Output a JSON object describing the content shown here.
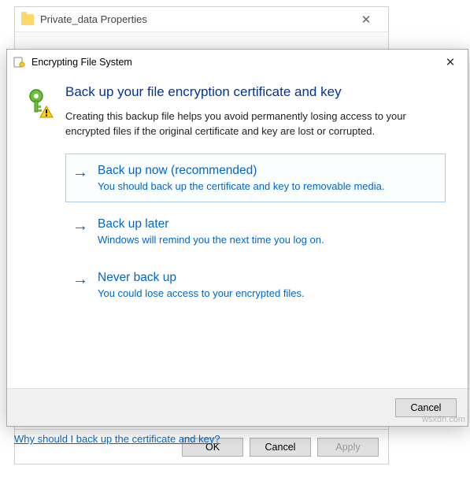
{
  "bg_window": {
    "title": "Private_data Properties",
    "buttons": {
      "ok": "OK",
      "cancel": "Cancel",
      "apply": "Apply"
    }
  },
  "dialog": {
    "title": "Encrypting File System",
    "heading": "Back up your file encryption certificate and key",
    "subtext": "Creating this backup file helps you avoid permanently losing access to your encrypted files if the original certificate and key are lost or corrupted.",
    "options": [
      {
        "title": "Back up now (recommended)",
        "desc": "You should back up the certificate and key to removable media."
      },
      {
        "title": "Back up later",
        "desc": "Windows will remind you the next time you log on."
      },
      {
        "title": "Never back up",
        "desc": "You could lose access to your encrypted files."
      }
    ],
    "cancel": "Cancel"
  },
  "help_link": "Why should I back up the certificate and key?",
  "watermark": "wsxdn.com"
}
